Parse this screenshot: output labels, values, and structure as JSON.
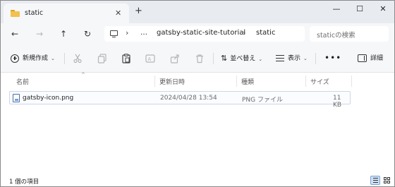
{
  "window": {
    "tab_title": "static",
    "tab_close": "✕",
    "new_tab": "+",
    "minimize": "—",
    "maximize": "☐",
    "close": "✕"
  },
  "nav": {
    "back": "←",
    "forward": "→",
    "up": "↑",
    "refresh": "↻",
    "breadcrumbs": [
      "…",
      "gatsby-static-site-tutorial",
      "static"
    ],
    "crumb_separator": "›",
    "search_placeholder": "staticの検索"
  },
  "commands": {
    "new_label": "新規作成",
    "sort_label": "並べ替え",
    "view_label": "表示",
    "more_label": "•••",
    "details_label": "詳細",
    "chevron": "⌄",
    "icons": [
      "cut-icon",
      "copy-icon",
      "paste-icon",
      "rename-icon",
      "share-icon",
      "delete-icon"
    ]
  },
  "columns": {
    "name": "名前",
    "modified": "更新日時",
    "type": "種類",
    "size": "サイズ",
    "sort_indicator": "^"
  },
  "files": [
    {
      "name": "gatsby-icon.png",
      "modified": "2024/04/28 13:54",
      "type": "PNG ファイル",
      "size": "11 KB"
    }
  ],
  "status": {
    "item_count": "1 個の項目"
  },
  "colors": {
    "titlebar": "#e8ebf0",
    "toolbar": "#f6f7f9",
    "folder": "#f2c14e",
    "selection_border": "#cfd7e4"
  }
}
